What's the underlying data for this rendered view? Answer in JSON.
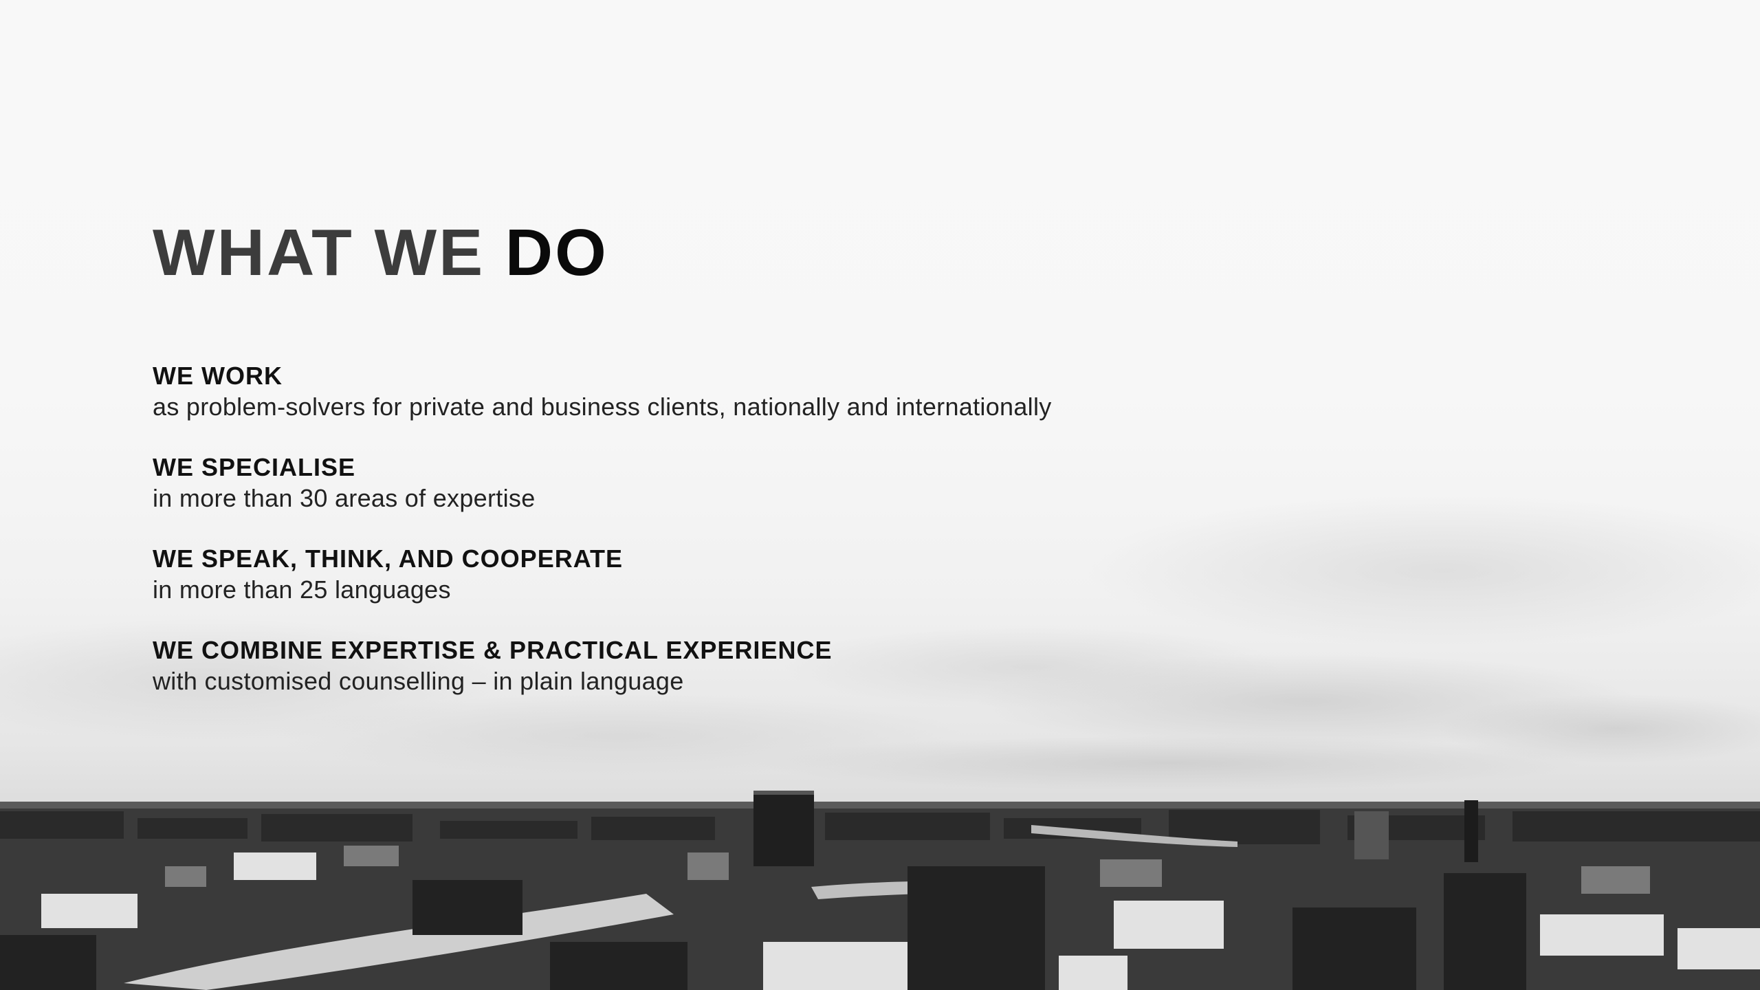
{
  "headline": {
    "part1": "WHAT WE",
    "part2": "DO"
  },
  "items": [
    {
      "title": "WE WORK",
      "text": "as problem-solvers for private and business clients, nationally and internationally"
    },
    {
      "title": "WE SPECIALISE",
      "text": "in more than 30 areas of expertise"
    },
    {
      "title": "WE SPEAK, THINK, AND COOPERATE",
      "text": "in more than 25 languages"
    },
    {
      "title": "WE COMBINE EXPERTISE & PRACTICAL EXPERIENCE",
      "text": "with customised counselling – in plain language"
    }
  ],
  "colors": {
    "background": "#f8f8f8",
    "headline_light": "#3c3c3c",
    "headline_dark": "#0a0a0a",
    "text": "#111111"
  }
}
